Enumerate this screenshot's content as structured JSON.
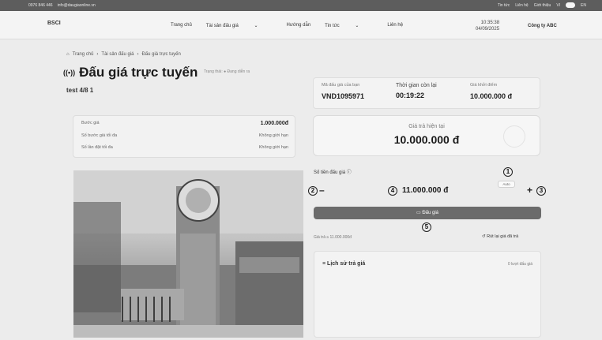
{
  "topbar": {
    "phone": "0976 846 446",
    "email": "info@daugiaonline.vn",
    "links": [
      "Tin tức",
      "Liên hệ",
      "Giới thiệu"
    ],
    "lang_vi": "VI",
    "lang_en": "EN"
  },
  "header": {
    "logo": "BSCI",
    "nav": [
      "Trang chủ",
      "Tài sản đấu giá",
      "Hướng dẫn",
      "Tin tức",
      "Liên hệ"
    ],
    "time": "10:35:38",
    "date": "04/09/2025",
    "company": "Công ty ABC"
  },
  "breadcrumb": [
    "Trang chủ",
    "Tài sản đấu giá",
    "Đấu giá trực tuyến"
  ],
  "page": {
    "title": "Đấu giá trực tuyến",
    "status_label": "Trạng thái:",
    "status_value": "Đang diễn ra",
    "subtitle": "test 4/8 1"
  },
  "info": {
    "code_label": "Mã đấu giá của bạn",
    "code_value": "VND1095971",
    "time_label": "Thời gian còn lại",
    "time_value": "00:19:22",
    "start_label": "Giá khởi điểm",
    "start_value": "10.000.000 đ"
  },
  "steps": {
    "step_label": "Bước giá",
    "step_value": "1.000.000đ",
    "max_step_label": "Số bước giá tối đa",
    "max_step_value": "Không giới hạn",
    "max_bids_label": "Số lần đặt tối đa",
    "max_bids_value": "Không giới hạn"
  },
  "current_price": {
    "label": "Giá trả hiện tại",
    "value": "10.000.000 đ"
  },
  "bid": {
    "label": "Số tiền đấu giá",
    "value": "11.000.000 đ",
    "auto_label": "Auto",
    "button_label": "Đấu giá",
    "min_bid": "Giá trả ≥ 11.000.000đ",
    "withdraw_label": "Rút lại giá đã trả"
  },
  "history": {
    "title": "Lịch sử trả giá",
    "count": "0 lượt đấu giá"
  },
  "annotations": [
    "1",
    "2",
    "3",
    "4",
    "5"
  ]
}
